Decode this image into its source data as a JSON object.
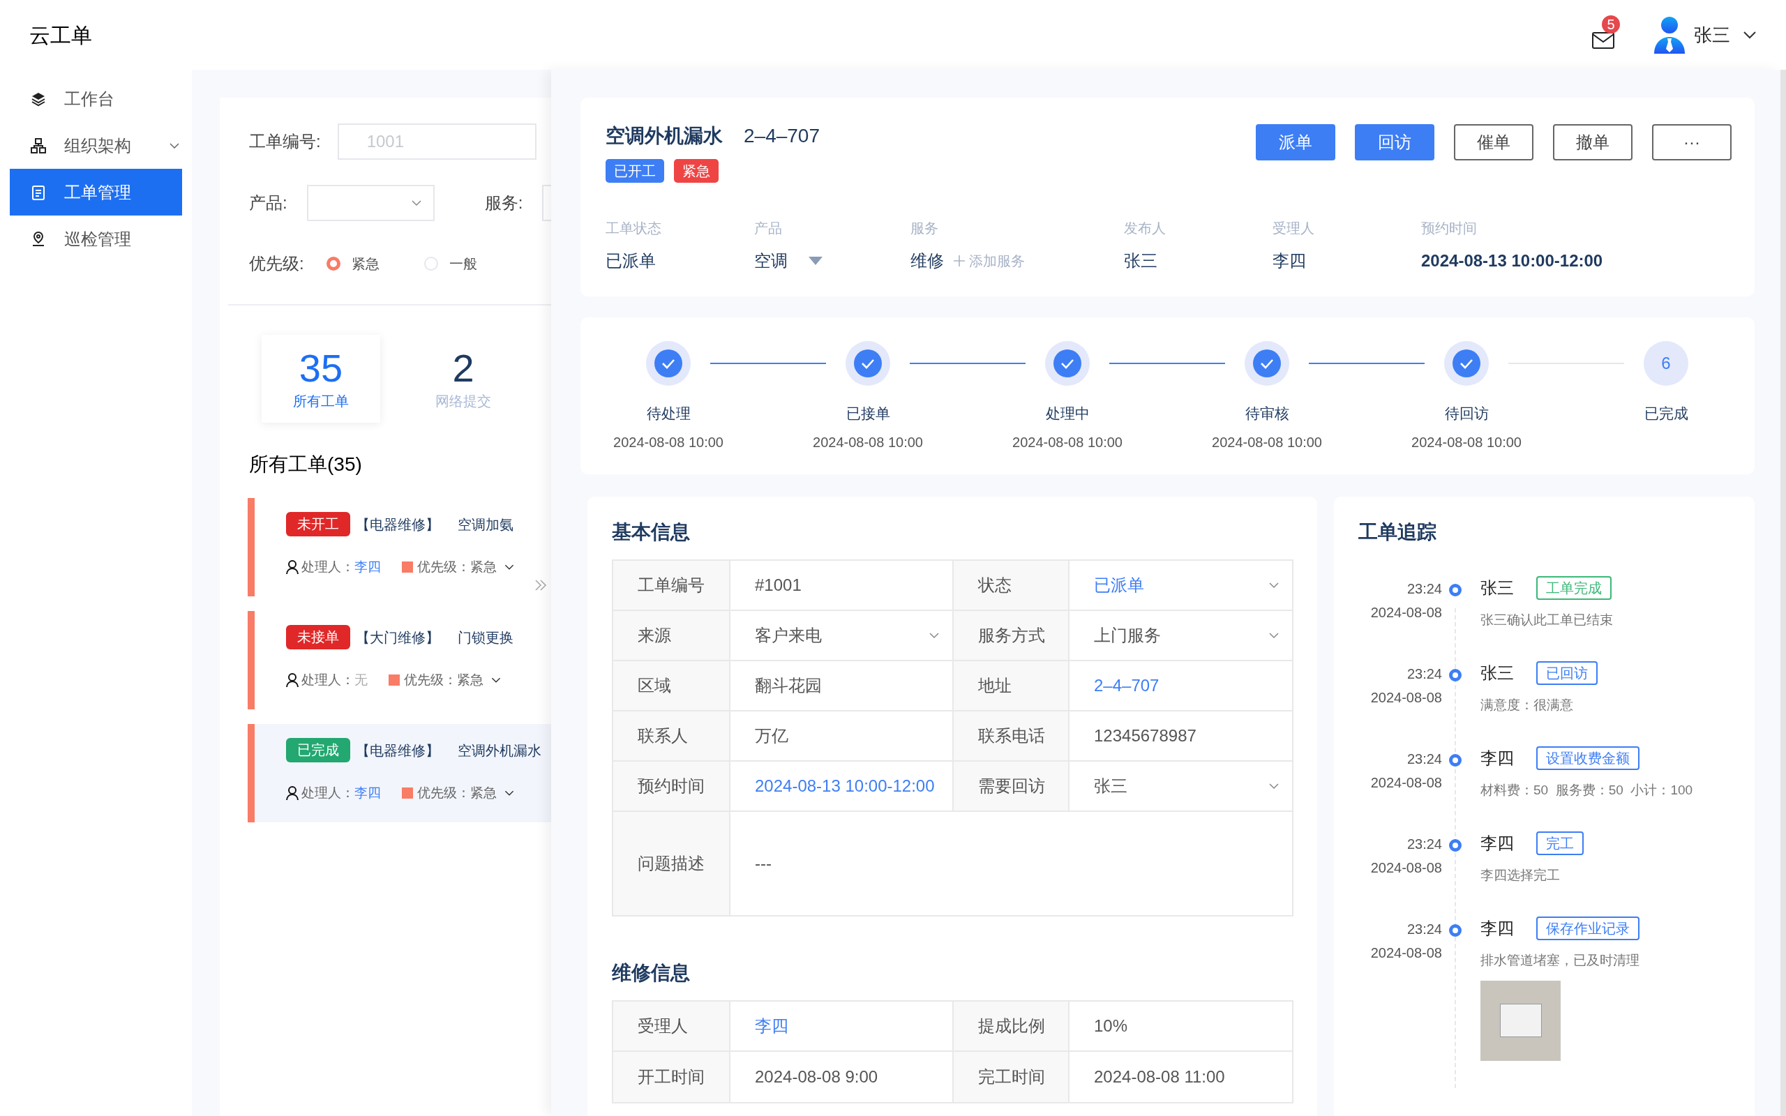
{
  "app": {
    "title": "云工单"
  },
  "header": {
    "mail_badge": "5",
    "user": "张三"
  },
  "sidebar": {
    "items": [
      {
        "label": "工作台",
        "selected": false,
        "expandable": false
      },
      {
        "label": "组织架构",
        "selected": false,
        "expandable": true
      },
      {
        "label": "工单管理",
        "selected": true,
        "expandable": false
      },
      {
        "label": "巡检管理",
        "selected": false,
        "expandable": false
      }
    ]
  },
  "filters": {
    "order_no": {
      "label": "工单编号:",
      "placeholder": "1001"
    },
    "product": {
      "label": "产品:"
    },
    "service": {
      "label": "服务:"
    },
    "priority": {
      "label": "优先级:",
      "options": [
        {
          "label": "紧急",
          "selected": true
        },
        {
          "label": "一般",
          "selected": false
        }
      ]
    }
  },
  "stats": [
    {
      "value": "35",
      "label": "所有工单",
      "selected": true
    },
    {
      "value": "2",
      "label": "网络提交",
      "selected": false
    }
  ],
  "list_title": "所有工单(35)",
  "orders": [
    {
      "status": "未开工",
      "color": "#e02828",
      "category": "【电器维修】",
      "title": "空调加氨",
      "handler_label": "处理人：",
      "handler": "李四",
      "assigned": true,
      "priority_label": "优先级：",
      "priority": "紧急",
      "selected": false
    },
    {
      "status": "未接单",
      "color": "#e02828",
      "category": "【大门维修】",
      "title": "门锁更换",
      "handler_label": "处理人：",
      "handler": "无",
      "assigned": false,
      "priority_label": "优先级：",
      "priority": "紧急",
      "selected": false
    },
    {
      "status": "已完成",
      "color": "#22a870",
      "category": "【电器维修】",
      "title": "空调外机漏水",
      "handler_label": "处理人：",
      "handler": "李四",
      "assigned": true,
      "priority_label": "优先级：",
      "priority": "紧急",
      "selected": true
    }
  ],
  "detail": {
    "title": "空调外机漏水",
    "address": "2–4–707",
    "tags": [
      {
        "label": "已开工",
        "color": "#3d7ef5"
      },
      {
        "label": "紧急",
        "color": "#ef4444"
      }
    ],
    "actions": [
      {
        "label": "派单",
        "kind": "primary"
      },
      {
        "label": "回访",
        "kind": "primary"
      },
      {
        "label": "催单",
        "kind": "outline"
      },
      {
        "label": "撤单",
        "kind": "outline"
      },
      {
        "label": "···",
        "kind": "outline"
      }
    ],
    "fields": [
      {
        "label": "工单状态",
        "value": "已派单",
        "kind": "text"
      },
      {
        "label": "产品",
        "value": "空调",
        "kind": "select"
      },
      {
        "label": "服务",
        "value": "维修",
        "kind": "service",
        "add": "添加服务"
      },
      {
        "label": "发布人",
        "value": "张三",
        "kind": "text"
      },
      {
        "label": "受理人",
        "value": "李四",
        "kind": "text"
      },
      {
        "label": "预约时间",
        "value": "2024-08-13 10:00-12:00",
        "kind": "strong"
      }
    ]
  },
  "steps": [
    {
      "label": "待处理",
      "time": "2024-08-08 10:00",
      "done": true
    },
    {
      "label": "已接单",
      "time": "2024-08-08 10:00",
      "done": true
    },
    {
      "label": "处理中",
      "time": "2024-08-08 10:00",
      "done": true
    },
    {
      "label": "待审核",
      "time": "2024-08-08 10:00",
      "done": true
    },
    {
      "label": "待回访",
      "time": "2024-08-08 10:00",
      "done": true
    },
    {
      "label": "已完成",
      "number": "6",
      "done": false
    }
  ],
  "basic_info": {
    "title": "基本信息",
    "rows": [
      [
        {
          "label": "工单编号",
          "value": "#1001",
          "link": false,
          "dropdown": false
        },
        {
          "label": "状态",
          "value": "已派单",
          "link": true,
          "dropdown": true
        }
      ],
      [
        {
          "label": "来源",
          "value": "客户来电",
          "link": false,
          "dropdown": true
        },
        {
          "label": "服务方式",
          "value": "上门服务",
          "link": false,
          "dropdown": true
        }
      ],
      [
        {
          "label": "区域",
          "value": "翻斗花园",
          "link": false,
          "dropdown": false
        },
        {
          "label": "地址",
          "value": "2–4–707",
          "link": true,
          "dropdown": false
        }
      ],
      [
        {
          "label": "联系人",
          "value": "万亿",
          "link": false,
          "dropdown": false
        },
        {
          "label": "联系电话",
          "value": "12345678987",
          "link": false,
          "dropdown": false
        }
      ],
      [
        {
          "label": "预约时间",
          "value": "2024-08-13 10:00-12:00",
          "link": true,
          "dropdown": false
        },
        {
          "label": "需要回访",
          "value": "张三",
          "link": false,
          "dropdown": true
        }
      ],
      [
        {
          "label": "问题描述",
          "value": "---",
          "link": false,
          "dropdown": false
        }
      ]
    ]
  },
  "repair_info": {
    "title": "维修信息",
    "rows": [
      [
        {
          "label": "受理人",
          "value": "李四",
          "link": true,
          "dropdown": false
        },
        {
          "label": "提成比例",
          "value": "10%",
          "link": false,
          "dropdown": false
        }
      ],
      [
        {
          "label": "开工时间",
          "value": "2024-08-08 9:00",
          "link": false,
          "dropdown": false
        },
        {
          "label": "完工时间",
          "value": "2024-08-08 11:00",
          "link": false,
          "dropdown": false
        }
      ]
    ]
  },
  "tracking": {
    "title": "工单追踪",
    "entries": [
      {
        "time": "23:24",
        "date": "2024-08-08",
        "name": "张三",
        "action": "工单完成",
        "color": "#3cb878",
        "note": "张三确认此工单已结束",
        "photo": false
      },
      {
        "time": "23:24",
        "date": "2024-08-08",
        "name": "张三",
        "action": "已回访",
        "color": "#3d7ef5",
        "note": "满意度：很满意",
        "photo": false
      },
      {
        "time": "23:24",
        "date": "2024-08-08",
        "name": "李四",
        "action": "设置收费金额",
        "color": "#3d7ef5",
        "note": "材料费：50  服务费：50  小计：100",
        "photo": false
      },
      {
        "time": "23:24",
        "date": "2024-08-08",
        "name": "李四",
        "action": "完工",
        "color": "#3d7ef5",
        "note": "李四选择完工",
        "photo": false
      },
      {
        "time": "23:24",
        "date": "2024-08-08",
        "name": "李四",
        "action": "保存作业记录",
        "color": "#3d7ef5",
        "note": "排水管道堵塞，已及时清理",
        "photo": true
      }
    ]
  }
}
